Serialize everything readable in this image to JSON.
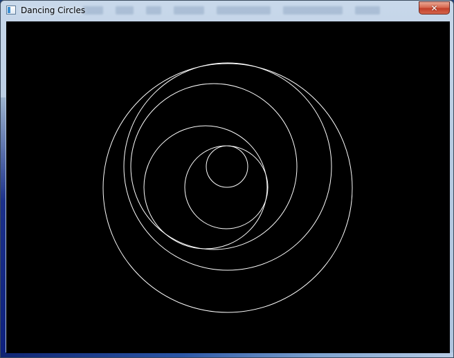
{
  "window": {
    "title": "Dancing Circles",
    "close_glyph": "✕",
    "app_icon": "window-app-icon",
    "close_icon": "close-icon"
  },
  "canvas": {
    "background": "#000000",
    "stroke": "#ffffff"
  }
}
